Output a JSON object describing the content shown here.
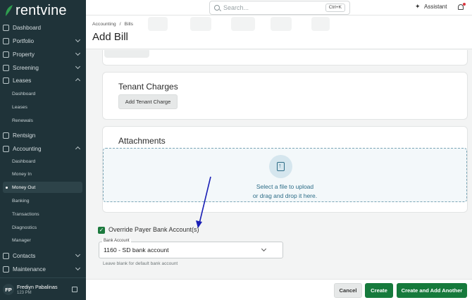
{
  "app": {
    "brand": "rentvine",
    "brand_color": "#2f9e4f",
    "accent": "#167a3c"
  },
  "search": {
    "placeholder": "Search...",
    "shortcut": "Ctrl+K"
  },
  "topbar": {
    "assistant_label": "Assistant"
  },
  "sidebar": {
    "items": [
      {
        "label": "Dashboard",
        "icon": "dashboard-icon",
        "chevron": false
      },
      {
        "label": "Portfolio",
        "icon": "portfolio-icon",
        "chevron": true
      },
      {
        "label": "Property",
        "icon": "property-icon",
        "chevron": true
      },
      {
        "label": "Screening",
        "icon": "screening-icon",
        "chevron": true
      },
      {
        "label": "Leases",
        "icon": "leases-icon",
        "chevron": true
      }
    ],
    "leases_sub": [
      "Dashboard",
      "Leases",
      "Renewals"
    ],
    "rentsign": {
      "label": "Rentsign",
      "icon": "rentsign-icon"
    },
    "accounting": {
      "label": "Accounting",
      "icon": "accounting-icon"
    },
    "accounting_sub": [
      "Dashboard",
      "Money In",
      "Money Out",
      "Banking",
      "Transactions",
      "Diagnostics",
      "Manager"
    ],
    "accounting_active": "Money Out",
    "contacts": {
      "label": "Contacts",
      "icon": "contacts-icon"
    },
    "maintenance": {
      "label": "Maintenance",
      "icon": "maintenance-icon"
    },
    "user": {
      "initials": "FP",
      "name": "Frediyn Pabalinas",
      "sub": "123 PM"
    }
  },
  "header": {
    "breadcrumbs": [
      "Accounting",
      "/",
      "Bills"
    ],
    "title": "Add Bill"
  },
  "tenant_charges": {
    "title": "Tenant Charges",
    "button": "Add Tenant Charge"
  },
  "attachments": {
    "title": "Attachments",
    "line1": "Select a file to upload",
    "line2": "or drag and drop it here."
  },
  "override": {
    "label": "Override Payer Bank Account(s)",
    "checked": true
  },
  "bank_account": {
    "label": "Bank Account",
    "value": "1160 - SD bank account",
    "help": "Leave blank for default bank account"
  },
  "footer": {
    "cancel": "Cancel",
    "create": "Create",
    "create_another": "Create and Add Another"
  }
}
